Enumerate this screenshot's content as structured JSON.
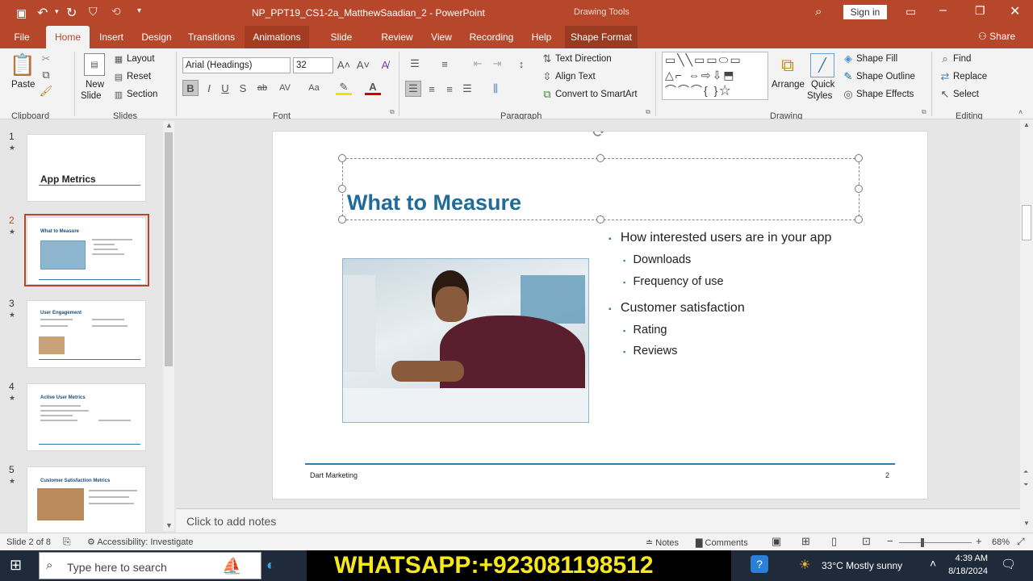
{
  "titlebar": {
    "doc_title": "NP_PPT19_CS1-2a_MatthewSaadian_2  -  PowerPoint",
    "context_label": "Drawing Tools",
    "signin": "Sign in"
  },
  "tabs": {
    "file": "File",
    "home": "Home",
    "insert": "Insert",
    "design": "Design",
    "transitions": "Transitions",
    "animations": "Animations",
    "slideshow": "Slide Show",
    "review": "Review",
    "view": "View",
    "recording": "Recording",
    "help": "Help",
    "shapeformat": "Shape Format",
    "share": "Share"
  },
  "ribbon": {
    "clipboard": {
      "label": "Clipboard",
      "paste": "Paste"
    },
    "slides": {
      "label": "Slides",
      "new_slide": "New",
      "new_slide2": "Slide",
      "layout": "Layout",
      "reset": "Reset",
      "section": "Section"
    },
    "font": {
      "label": "Font",
      "family": "Arial (Headings)",
      "size": "32",
      "bold": "B",
      "italic": "I",
      "underline": "U",
      "shadow": "S",
      "strike": "ab",
      "spacing": "AV",
      "case": "Aa"
    },
    "paragraph": {
      "label": "Paragraph",
      "text_direction": "Text Direction",
      "align_text": "Align Text",
      "smartart": "Convert to SmartArt"
    },
    "drawing": {
      "label": "Drawing",
      "arrange": "Arrange",
      "quick": "Quick",
      "styles": "Styles",
      "fill": "Shape Fill",
      "outline": "Shape Outline",
      "effects": "Shape Effects"
    },
    "editing": {
      "label": "Editing",
      "find": "Find",
      "replace": "Replace",
      "select": "Select"
    }
  },
  "thumbnails": [
    {
      "num": "1",
      "title": "App Metrics"
    },
    {
      "num": "2",
      "title": "What to Measure"
    },
    {
      "num": "3",
      "title": "User Engagement"
    },
    {
      "num": "4",
      "title": "Active User Metrics"
    },
    {
      "num": "5",
      "title": "Customer Satisfaction Metrics"
    }
  ],
  "slide": {
    "title": "What to Measure",
    "bullets": [
      {
        "level": 1,
        "text": "How interested users are in your app"
      },
      {
        "level": 2,
        "text": "Downloads"
      },
      {
        "level": 2,
        "text": "Frequency of use"
      },
      {
        "level": 1,
        "text": "Customer satisfaction"
      },
      {
        "level": 2,
        "text": "Rating"
      },
      {
        "level": 2,
        "text": "Reviews"
      }
    ],
    "footer": "Dart Marketing",
    "page_number": "2"
  },
  "notes_placeholder": "Click to add notes",
  "status": {
    "slide_count": "Slide 2 of 8",
    "accessibility": "Accessibility: Investigate",
    "notes": "Notes",
    "comments": "Comments",
    "zoom": "68%"
  },
  "taskbar": {
    "search_placeholder": "Type here to search",
    "banner": "WHATSAPP:+923081198512",
    "weather": "33°C  Mostly sunny",
    "time": "4:39 AM",
    "date": "8/18/2024"
  },
  "colors": {
    "accent": "#b7472a",
    "title_blue": "#1f6b99",
    "bullet_teal": "#2e7da8"
  }
}
